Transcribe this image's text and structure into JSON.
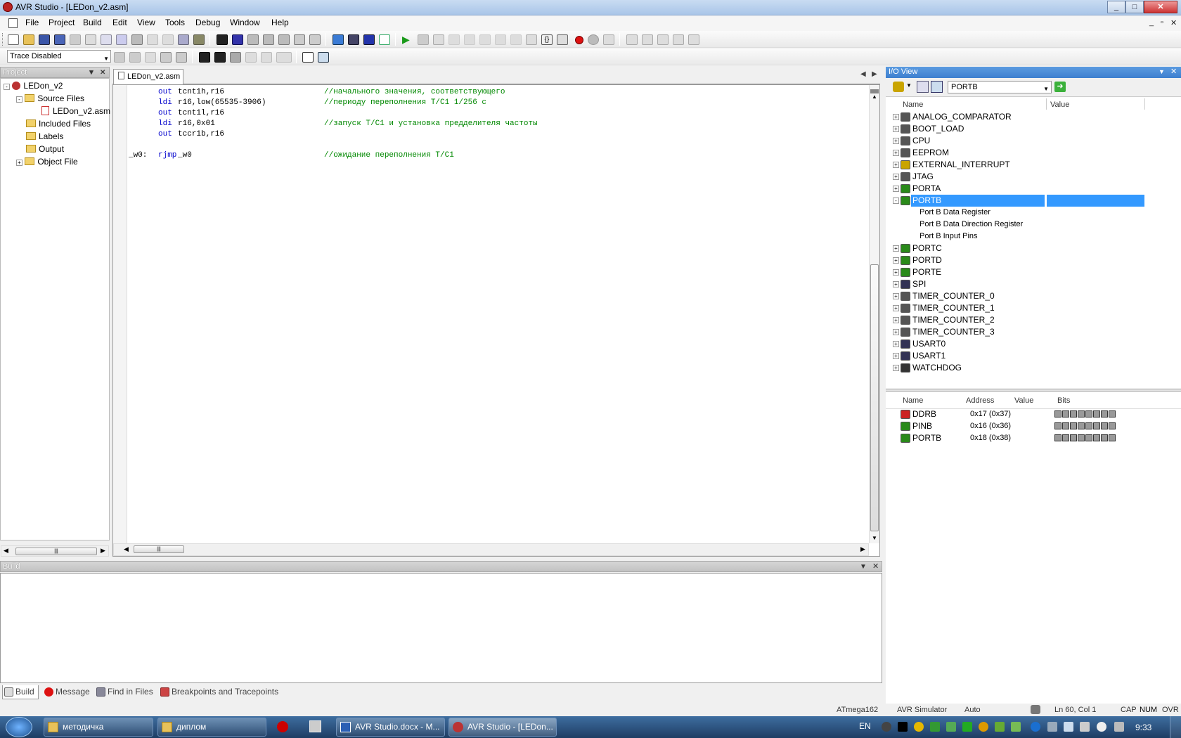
{
  "window": {
    "title": "AVR Studio - [LEDon_v2.asm]",
    "min": "_",
    "max": "□",
    "close": "✕"
  },
  "menu": [
    "File",
    "Project",
    "Build",
    "Edit",
    "View",
    "Tools",
    "Debug",
    "Window",
    "Help"
  ],
  "mdi": {
    "min": "_",
    "restore": "▫",
    "close": "✕"
  },
  "trace_combo": {
    "value": "Trace Disabled"
  },
  "project_panel": {
    "title": "Project",
    "root": "LEDon_v2",
    "source_files": "Source Files",
    "source_file": "LEDon_v2.asm",
    "included": "Included Files",
    "labels": "Labels",
    "output": "Output",
    "object": "Object File"
  },
  "editor": {
    "tab": "LEDon_v2.asm",
    "lines": [
      {
        "label": "",
        "op": "out",
        "args": "tcnt1h,r16",
        "comment": "//начального значения, соответствующего"
      },
      {
        "label": "",
        "op": "ldi",
        "args": "r16,low(65535-3906)",
        "comment": "//периоду переполнения Т/С1 1/256 с"
      },
      {
        "label": "",
        "op": "out",
        "args": "tcnt1l,r16",
        "comment": ""
      },
      {
        "label": "",
        "op": "ldi",
        "args": "r16,0x01",
        "comment": "//запуск Т/С1 и установка предделителя частоты"
      },
      {
        "label": "",
        "op": "out",
        "args": "tccr1b,r16",
        "comment": ""
      },
      {
        "label": "",
        "op": "",
        "args": "",
        "comment": ""
      },
      {
        "label": "_w0:",
        "op": "rjmp",
        "args": "_w0",
        "comment": "//ожидание переполнения Т/С1"
      }
    ]
  },
  "io_view": {
    "title": "I/O View",
    "combo": "PORTB",
    "col_name": "Name",
    "col_value": "Value",
    "items": [
      {
        "name": "ANALOG_COMPARATOR",
        "icon": "comparator-icon",
        "color": "#555"
      },
      {
        "name": "BOOT_LOAD",
        "icon": "boot-icon",
        "color": "#555"
      },
      {
        "name": "CPU",
        "icon": "cpu-icon",
        "color": "#555"
      },
      {
        "name": "EEPROM",
        "icon": "eeprom-icon",
        "color": "#555"
      },
      {
        "name": "EXTERNAL_INTERRUPT",
        "icon": "interrupt-icon",
        "color": "#c9a400"
      },
      {
        "name": "JTAG",
        "icon": "jtag-icon",
        "color": "#555"
      },
      {
        "name": "PORTA",
        "icon": "port-icon",
        "color": "#2a8a1a"
      },
      {
        "name": "PORTB",
        "icon": "port-icon",
        "color": "#2a8a1a",
        "selected": true,
        "expanded": true,
        "children": [
          "Port B Data Register",
          "Port B Data Direction Register",
          "Port B Input Pins"
        ]
      },
      {
        "name": "PORTC",
        "icon": "port-icon",
        "color": "#2a8a1a"
      },
      {
        "name": "PORTD",
        "icon": "port-icon",
        "color": "#2a8a1a"
      },
      {
        "name": "PORTE",
        "icon": "port-icon",
        "color": "#2a8a1a"
      },
      {
        "name": "SPI",
        "icon": "spi-icon",
        "color": "#335"
      },
      {
        "name": "TIMER_COUNTER_0",
        "icon": "timer-icon",
        "color": "#555"
      },
      {
        "name": "TIMER_COUNTER_1",
        "icon": "timer-icon",
        "color": "#555"
      },
      {
        "name": "TIMER_COUNTER_2",
        "icon": "timer-icon",
        "color": "#555"
      },
      {
        "name": "TIMER_COUNTER_3",
        "icon": "timer-icon",
        "color": "#555"
      },
      {
        "name": "USART0",
        "icon": "usart-icon",
        "color": "#335"
      },
      {
        "name": "USART1",
        "icon": "usart-icon",
        "color": "#335"
      },
      {
        "name": "WATCHDOG",
        "icon": "watchdog-icon",
        "color": "#333"
      }
    ],
    "reg_cols": {
      "name": "Name",
      "address": "Address",
      "value": "Value",
      "bits": "Bits"
    },
    "registers": [
      {
        "name": "DDRB",
        "address": "0x17 (0x37)",
        "icon": "flag-icon"
      },
      {
        "name": "PINB",
        "address": "0x16 (0x36)",
        "icon": "port-icon"
      },
      {
        "name": "PORTB",
        "address": "0x18 (0x38)",
        "icon": "port-icon"
      }
    ]
  },
  "build_panel": {
    "title": "Build",
    "tabs": [
      "Build",
      "Message",
      "Find in Files",
      "Breakpoints and Tracepoints"
    ]
  },
  "status": {
    "device": "ATmega162",
    "platform": "AVR Simulator",
    "mode": "Auto",
    "position": "Ln 60, Col 1",
    "cap": "CAP",
    "num": "NUM",
    "ovr": "OVR"
  },
  "taskbar": {
    "tasks": [
      "методичка",
      "диплом",
      "AVR Studio.docx - M...",
      "AVR Studio - [LEDon..."
    ],
    "lang": "EN",
    "clock": "9:33"
  },
  "colors": {
    "selection": "#3399ff",
    "keyword": "#0000cc",
    "comment": "#008800"
  }
}
